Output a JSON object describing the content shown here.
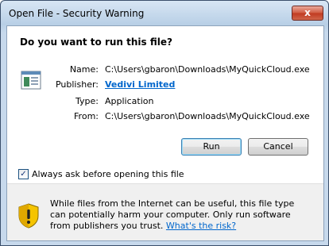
{
  "window": {
    "title": "Open File - Security Warning",
    "close_glyph": "x"
  },
  "dialog": {
    "heading": "Do you want to run this file?",
    "fields": {
      "name_label": "Name:",
      "name_value": "C:\\Users\\gbaron\\Downloads\\MyQuickCloud.exe",
      "publisher_label": "Publisher:",
      "publisher_value": "Vedivi Limited",
      "type_label": "Type:",
      "type_value": "Application",
      "from_label": "From:",
      "from_value": "C:\\Users\\gbaron\\Downloads\\MyQuickCloud.exe"
    },
    "buttons": {
      "run": "Run",
      "cancel": "Cancel"
    },
    "checkbox": {
      "label": "Always ask before opening this file",
      "checked": true
    },
    "warning": {
      "text": "While files from the Internet can be useful, this file type can potentially harm your computer. Only run software from publishers you trust.",
      "link": "What's the risk?"
    }
  },
  "icons": {
    "file": "application-file-icon",
    "shield": "warning-shield-icon",
    "close": "close-icon"
  },
  "colors": {
    "link": "#0066cc",
    "close_button": "#c03920",
    "shield_yellow": "#f5c400"
  }
}
